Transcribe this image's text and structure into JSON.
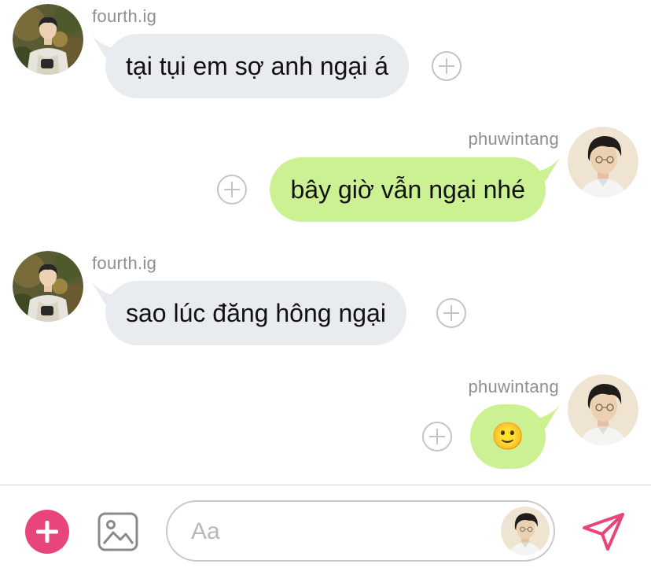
{
  "messages": [
    {
      "sender": "fourth.ig",
      "text": "tại tụi em sợ anh ngại á",
      "direction": "in"
    },
    {
      "sender": "phuwintang",
      "text": "bây giờ vẫn ngại nhé",
      "direction": "out"
    },
    {
      "sender": "fourth.ig",
      "text": "sao lúc đăng hông ngại",
      "direction": "in"
    },
    {
      "sender": "phuwintang",
      "text": "🙂",
      "direction": "out"
    }
  ],
  "composer": {
    "placeholder": "Aa"
  },
  "icons": {
    "add": "plus-circle-icon",
    "gallery": "image-icon",
    "send": "paper-plane-icon",
    "react": "add-reaction-icon"
  },
  "colors": {
    "incoming_bubble": "#e9ecef",
    "outgoing_bubble": "#ccf193",
    "accent": "#e8457a",
    "muted": "#8e8e93"
  }
}
